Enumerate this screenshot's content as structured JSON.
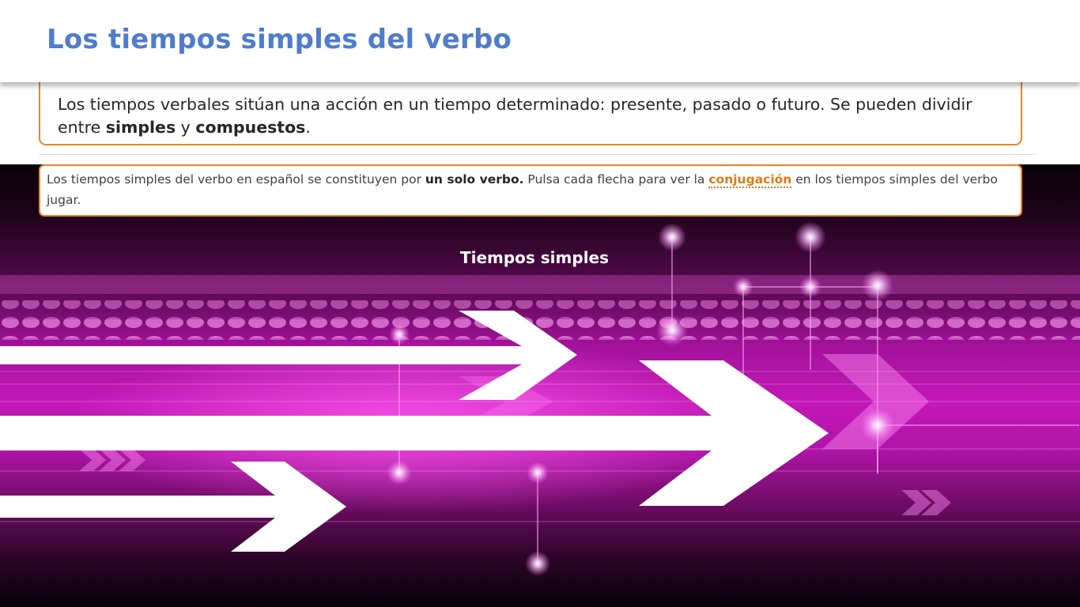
{
  "header": {
    "title": "Los tiempos simples del verbo"
  },
  "intro": {
    "text_before": "Los tiempos verbales sitúan una acción en un tiempo determinado: presente, pasado o futuro. Se pueden dividir entre ",
    "bold_1": "simples",
    "connector": " y ",
    "bold_2": "compuestos",
    "end": "."
  },
  "info": {
    "text_before": "Los tiempos simples del verbo en español se constituyen por ",
    "bold": "un solo verbo.",
    "middle": " Pulsa cada flecha para ver  la ",
    "link": "conjugación",
    "after": " en los tiempos simples del verbo jugar."
  },
  "banner": {
    "subtitle": "Tiempos simples"
  },
  "arrows": [
    {
      "icon": "arrow-right-icon"
    },
    {
      "icon": "arrow-right-icon"
    },
    {
      "icon": "arrow-right-icon"
    }
  ],
  "colors": {
    "title": "#4f7ccc",
    "accent": "#e8852e",
    "link": "#e07a17",
    "banner": "#c318b8"
  }
}
